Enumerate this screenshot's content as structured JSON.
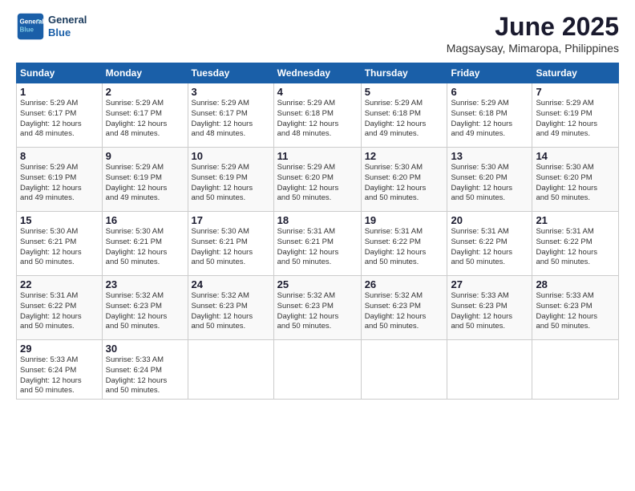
{
  "logo": {
    "line1": "General",
    "line2": "Blue"
  },
  "title": "June 2025",
  "location": "Magsaysay, Mimaropa, Philippines",
  "weekdays": [
    "Sunday",
    "Monday",
    "Tuesday",
    "Wednesday",
    "Thursday",
    "Friday",
    "Saturday"
  ],
  "weeks": [
    [
      {
        "day": "1",
        "info": "Sunrise: 5:29 AM\nSunset: 6:17 PM\nDaylight: 12 hours\nand 48 minutes."
      },
      {
        "day": "2",
        "info": "Sunrise: 5:29 AM\nSunset: 6:17 PM\nDaylight: 12 hours\nand 48 minutes."
      },
      {
        "day": "3",
        "info": "Sunrise: 5:29 AM\nSunset: 6:17 PM\nDaylight: 12 hours\nand 48 minutes."
      },
      {
        "day": "4",
        "info": "Sunrise: 5:29 AM\nSunset: 6:18 PM\nDaylight: 12 hours\nand 48 minutes."
      },
      {
        "day": "5",
        "info": "Sunrise: 5:29 AM\nSunset: 6:18 PM\nDaylight: 12 hours\nand 49 minutes."
      },
      {
        "day": "6",
        "info": "Sunrise: 5:29 AM\nSunset: 6:18 PM\nDaylight: 12 hours\nand 49 minutes."
      },
      {
        "day": "7",
        "info": "Sunrise: 5:29 AM\nSunset: 6:19 PM\nDaylight: 12 hours\nand 49 minutes."
      }
    ],
    [
      {
        "day": "8",
        "info": "Sunrise: 5:29 AM\nSunset: 6:19 PM\nDaylight: 12 hours\nand 49 minutes."
      },
      {
        "day": "9",
        "info": "Sunrise: 5:29 AM\nSunset: 6:19 PM\nDaylight: 12 hours\nand 49 minutes."
      },
      {
        "day": "10",
        "info": "Sunrise: 5:29 AM\nSunset: 6:19 PM\nDaylight: 12 hours\nand 50 minutes."
      },
      {
        "day": "11",
        "info": "Sunrise: 5:29 AM\nSunset: 6:20 PM\nDaylight: 12 hours\nand 50 minutes."
      },
      {
        "day": "12",
        "info": "Sunrise: 5:30 AM\nSunset: 6:20 PM\nDaylight: 12 hours\nand 50 minutes."
      },
      {
        "day": "13",
        "info": "Sunrise: 5:30 AM\nSunset: 6:20 PM\nDaylight: 12 hours\nand 50 minutes."
      },
      {
        "day": "14",
        "info": "Sunrise: 5:30 AM\nSunset: 6:20 PM\nDaylight: 12 hours\nand 50 minutes."
      }
    ],
    [
      {
        "day": "15",
        "info": "Sunrise: 5:30 AM\nSunset: 6:21 PM\nDaylight: 12 hours\nand 50 minutes."
      },
      {
        "day": "16",
        "info": "Sunrise: 5:30 AM\nSunset: 6:21 PM\nDaylight: 12 hours\nand 50 minutes."
      },
      {
        "day": "17",
        "info": "Sunrise: 5:30 AM\nSunset: 6:21 PM\nDaylight: 12 hours\nand 50 minutes."
      },
      {
        "day": "18",
        "info": "Sunrise: 5:31 AM\nSunset: 6:21 PM\nDaylight: 12 hours\nand 50 minutes."
      },
      {
        "day": "19",
        "info": "Sunrise: 5:31 AM\nSunset: 6:22 PM\nDaylight: 12 hours\nand 50 minutes."
      },
      {
        "day": "20",
        "info": "Sunrise: 5:31 AM\nSunset: 6:22 PM\nDaylight: 12 hours\nand 50 minutes."
      },
      {
        "day": "21",
        "info": "Sunrise: 5:31 AM\nSunset: 6:22 PM\nDaylight: 12 hours\nand 50 minutes."
      }
    ],
    [
      {
        "day": "22",
        "info": "Sunrise: 5:31 AM\nSunset: 6:22 PM\nDaylight: 12 hours\nand 50 minutes."
      },
      {
        "day": "23",
        "info": "Sunrise: 5:32 AM\nSunset: 6:23 PM\nDaylight: 12 hours\nand 50 minutes."
      },
      {
        "day": "24",
        "info": "Sunrise: 5:32 AM\nSunset: 6:23 PM\nDaylight: 12 hours\nand 50 minutes."
      },
      {
        "day": "25",
        "info": "Sunrise: 5:32 AM\nSunset: 6:23 PM\nDaylight: 12 hours\nand 50 minutes."
      },
      {
        "day": "26",
        "info": "Sunrise: 5:32 AM\nSunset: 6:23 PM\nDaylight: 12 hours\nand 50 minutes."
      },
      {
        "day": "27",
        "info": "Sunrise: 5:33 AM\nSunset: 6:23 PM\nDaylight: 12 hours\nand 50 minutes."
      },
      {
        "day": "28",
        "info": "Sunrise: 5:33 AM\nSunset: 6:23 PM\nDaylight: 12 hours\nand 50 minutes."
      }
    ],
    [
      {
        "day": "29",
        "info": "Sunrise: 5:33 AM\nSunset: 6:24 PM\nDaylight: 12 hours\nand 50 minutes."
      },
      {
        "day": "30",
        "info": "Sunrise: 5:33 AM\nSunset: 6:24 PM\nDaylight: 12 hours\nand 50 minutes."
      },
      {
        "day": "",
        "info": ""
      },
      {
        "day": "",
        "info": ""
      },
      {
        "day": "",
        "info": ""
      },
      {
        "day": "",
        "info": ""
      },
      {
        "day": "",
        "info": ""
      }
    ]
  ]
}
